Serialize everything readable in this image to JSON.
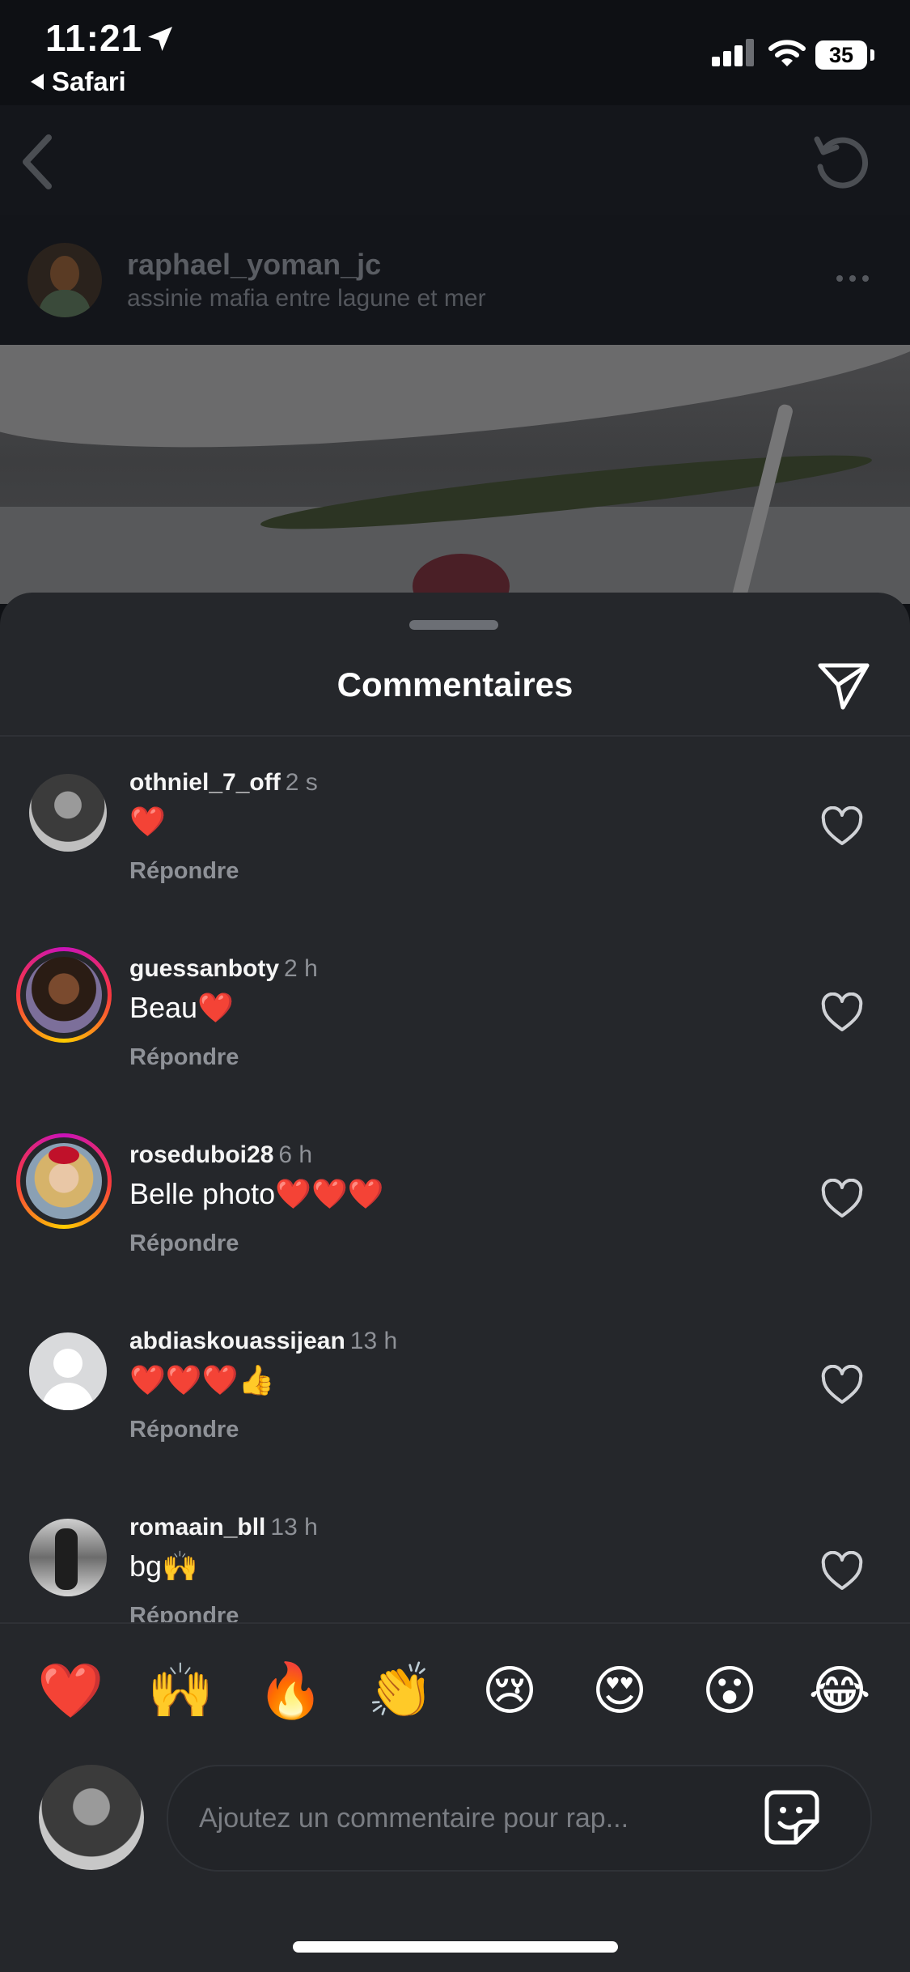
{
  "status_bar": {
    "time": "11:21",
    "back_app": "Safari",
    "battery": "35"
  },
  "post": {
    "username": "raphael_yoman_jc",
    "location": "assinie mafia entre lagune et mer"
  },
  "sheet": {
    "title": "Commentaires"
  },
  "reply_label": "Répondre",
  "comments": [
    {
      "user": "othniel_7_off",
      "time": "2 s",
      "text": "❤️"
    },
    {
      "user": "guessanboty",
      "time": "2 h",
      "text": "Beau❤️"
    },
    {
      "user": "roseduboi28",
      "time": "6 h",
      "text": "Belle photo❤️❤️❤️"
    },
    {
      "user": "abdiaskouassijean",
      "time": "13 h",
      "text": "❤️❤️❤️👍"
    },
    {
      "user": "romaain_bll",
      "time": "13 h",
      "text": "bg🙌"
    }
  ],
  "emoji_bar": [
    "❤️",
    "🙌",
    "🔥",
    "👏",
    "😢",
    "😍",
    "😮",
    "😂"
  ],
  "compose": {
    "placeholder": "Ajoutez un commentaire pour rap..."
  }
}
